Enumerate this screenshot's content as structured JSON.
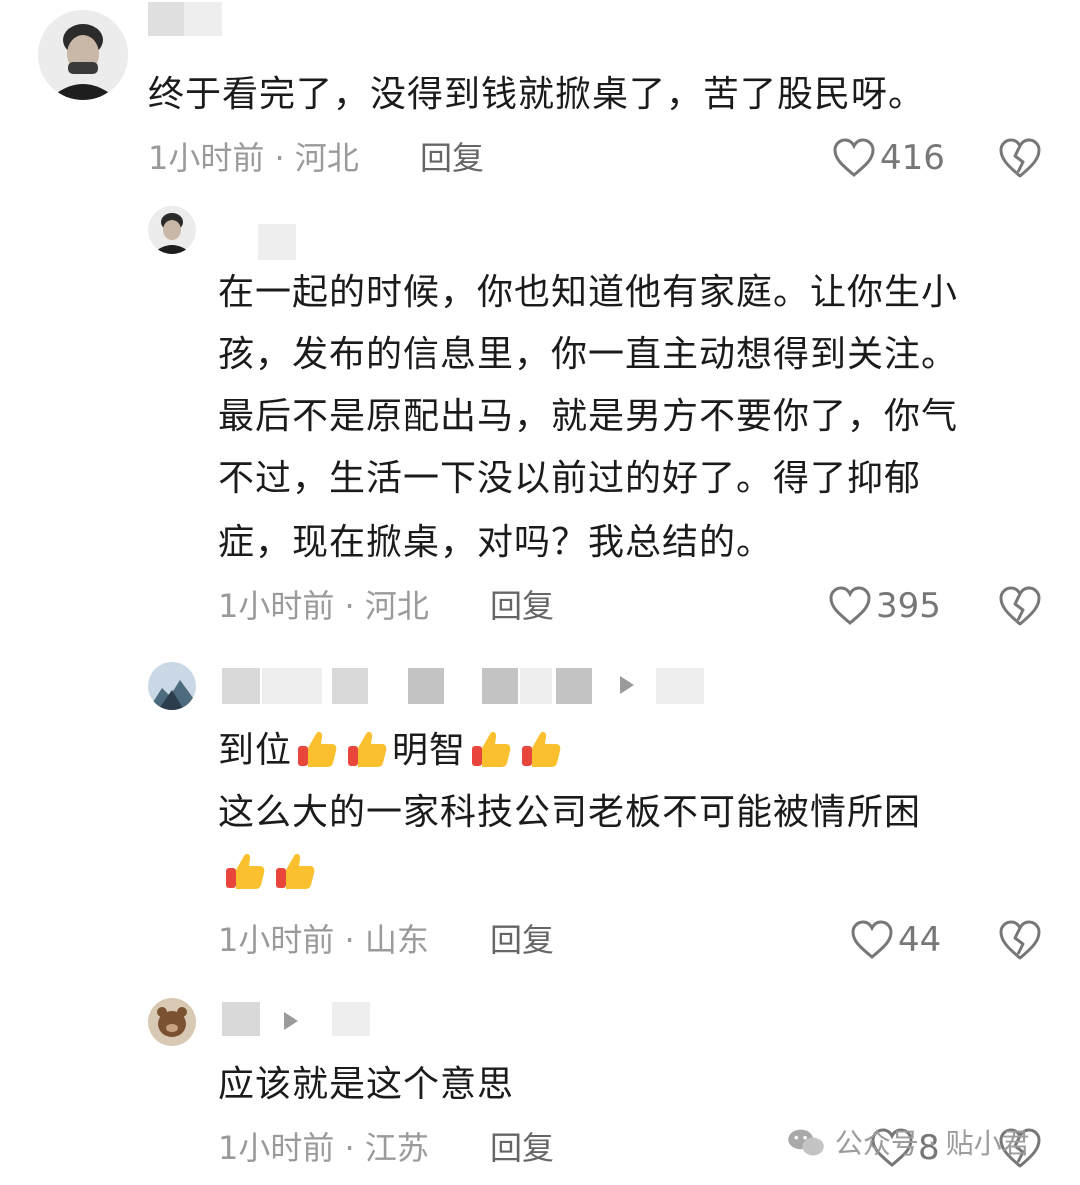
{
  "comments": [
    {
      "text": "终于看完了，没得到钱就掀桌了，苦了股民呀。",
      "time": "1小时前 · 河北",
      "reply": "回复",
      "likes": "416"
    },
    {
      "lines": [
        "在一起的时候，你也知道他有家庭。让你生小",
        "孩，发布的信息里，你一直主动想得到关注。",
        "最后不是原配出马，就是男方不要你了，你气",
        "不过，生活一下没以前过的好了。得了抑郁",
        "症，现在掀桌，对吗？我总结的。"
      ],
      "time": "1小时前 · 河北",
      "reply": "回复",
      "likes": "395"
    },
    {
      "line1_a": "到位",
      "line1_b": "明智",
      "line2": "这么大的一家科技公司老板不可能被情所困",
      "time": "1小时前 · 山东",
      "reply": "回复",
      "likes": "44"
    },
    {
      "text": "应该就是这个意思",
      "time": "1小时前 · 江苏",
      "reply": "回复",
      "likes": "8"
    }
  ],
  "icons": {
    "like": "heart-outline-icon",
    "dislike": "broken-heart-icon",
    "thumbs": "thumbs-up-emoji",
    "watermark": "wechat-icon"
  },
  "watermark": {
    "text": "公众号 · 贴小君"
  },
  "colors": {
    "meta": "#9a9a9a",
    "text": "#1b1b1b",
    "blur": "#d9d9d9"
  }
}
